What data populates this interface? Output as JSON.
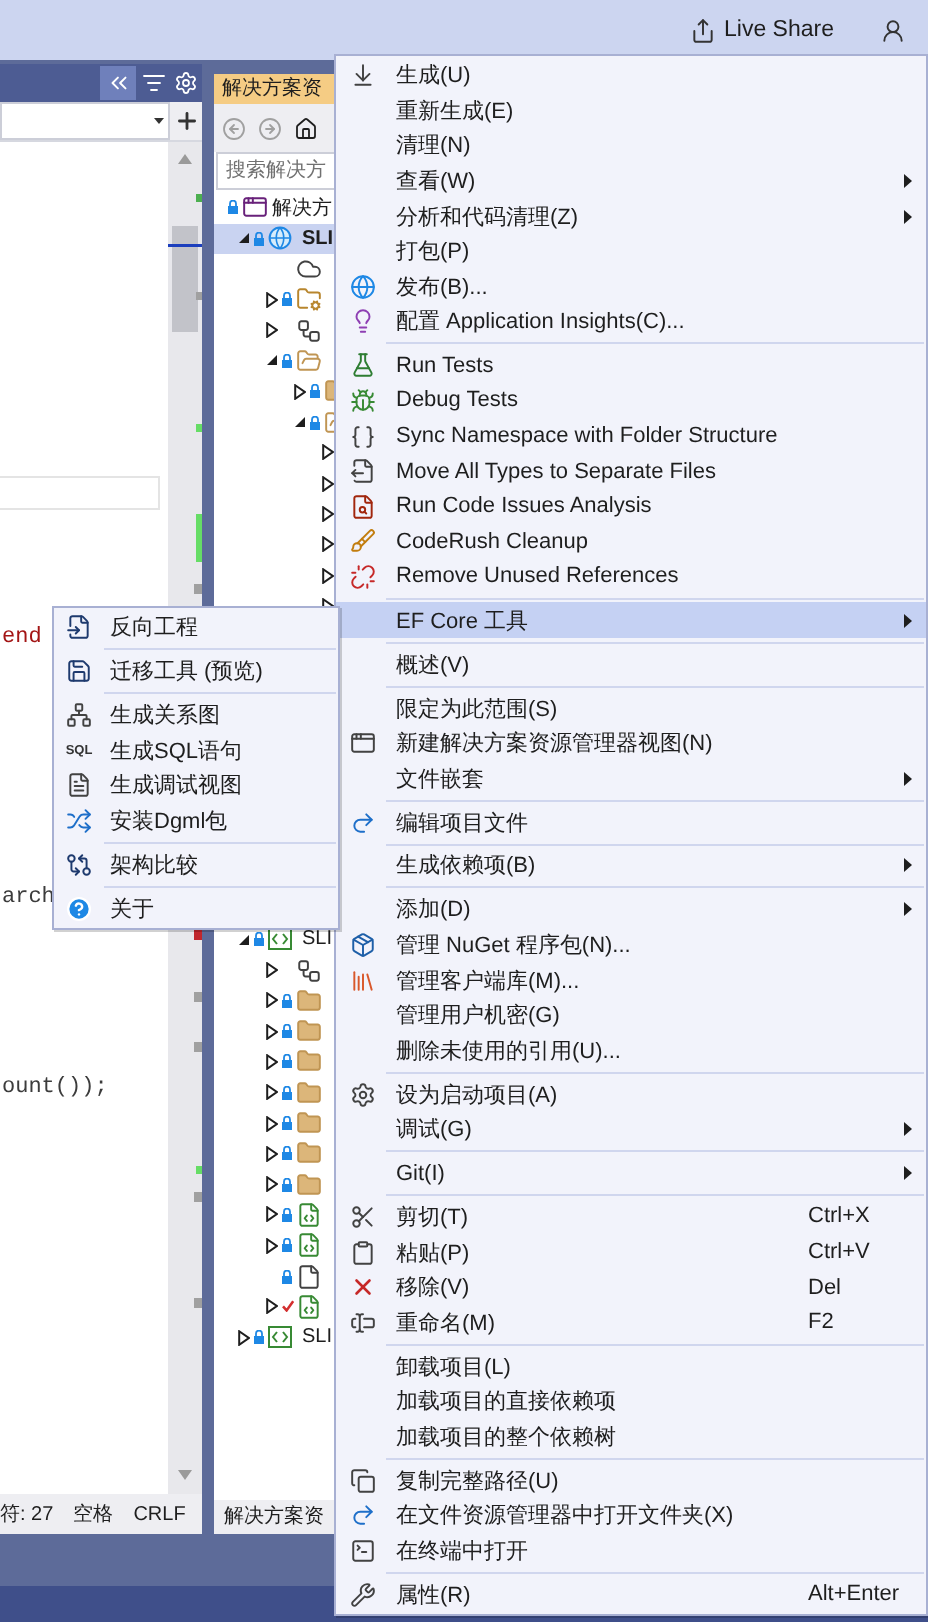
{
  "top_bar": {
    "live_share": "Live Share"
  },
  "editor": {
    "code_lines": [
      {
        "text": "end",
        "kind": "string"
      },
      {
        "text": "arch",
        "kind": "plain"
      },
      {
        "text": "ount());",
        "kind": "plain"
      }
    ],
    "status_bar": [
      "符: 27",
      "空格",
      "CRLF"
    ]
  },
  "solution_explorer": {
    "title": "解决方案资",
    "search": {
      "placeholder": "搜索解决方"
    },
    "tree": [
      {
        "label": "解决方",
        "kind": "solution",
        "locked": true,
        "selected": false,
        "children": [
          {
            "label": "SLI",
            "kind": "web-project",
            "locked": true,
            "expanded": true,
            "selected": true,
            "children": [
              {
                "kind": "cloud",
                "locked": false,
                "selected": false
              },
              {
                "kind": "folder-gear",
                "locked": true,
                "expanded": false,
                "selected": false
              },
              {
                "kind": "deps",
                "locked": false,
                "expanded": false,
                "selected": false
              },
              {
                "kind": "folder-open",
                "locked": true,
                "expanded": true,
                "selected": false,
                "children": [
                  {
                    "kind": "folder",
                    "locked": true,
                    "expanded": false,
                    "selected": false
                  },
                  {
                    "kind": "folder-open",
                    "locked": true,
                    "expanded": true,
                    "selected": false,
                    "children": [
                      {
                        "expanded": false,
                        "selected": false
                      },
                      {
                        "expanded": false,
                        "selected": false
                      },
                      {
                        "expanded": false,
                        "selected": false
                      },
                      {
                        "expanded": false,
                        "selected": false
                      },
                      {
                        "expanded": false,
                        "selected": false
                      },
                      {
                        "expanded": false,
                        "selected": false
                      }
                    ]
                  }
                ]
              }
            ]
          },
          {
            "label": "SLI",
            "kind": "cs-project",
            "locked": true,
            "expanded": true,
            "selected": false,
            "children": [
              {
                "kind": "deps",
                "locked": false,
                "expanded": false,
                "selected": false
              },
              {
                "kind": "folder",
                "locked": true,
                "expanded": false,
                "selected": false
              },
              {
                "kind": "folder",
                "locked": true,
                "expanded": false,
                "selected": false
              },
              {
                "kind": "folder",
                "locked": true,
                "expanded": false,
                "selected": false
              },
              {
                "kind": "folder",
                "locked": true,
                "expanded": false,
                "selected": false
              },
              {
                "kind": "folder",
                "locked": true,
                "expanded": false,
                "selected": false
              },
              {
                "kind": "folder",
                "locked": true,
                "expanded": false,
                "selected": false
              },
              {
                "kind": "folder",
                "locked": true,
                "expanded": false,
                "selected": false
              },
              {
                "kind": "cs-file",
                "locked": true,
                "expanded": false,
                "selected": false
              },
              {
                "kind": "cs-file",
                "locked": true,
                "expanded": false,
                "selected": false
              },
              {
                "kind": "file",
                "locked": true,
                "selected": false
              },
              {
                "kind": "cs-file",
                "locked": false,
                "edited": true,
                "expanded": false,
                "selected": false
              }
            ]
          },
          {
            "label": "SLI",
            "kind": "cs-project",
            "locked": true,
            "expanded": false,
            "selected": false
          }
        ]
      }
    ],
    "bottom_tab": "解决方案资"
  },
  "context_menu": {
    "groups": [
      {
        "items": [
          {
            "label": "生成(U)",
            "kind": "build",
            "submenu": false,
            "highlighted": false
          },
          {
            "label": "重新生成(E)",
            "submenu": false,
            "highlighted": false
          },
          {
            "label": "清理(N)",
            "submenu": false,
            "highlighted": false
          },
          {
            "label": "查看(W)",
            "submenu": true,
            "highlighted": false
          },
          {
            "label": "分析和代码清理(Z)",
            "submenu": true,
            "highlighted": false
          },
          {
            "label": "打包(P)",
            "submenu": false,
            "highlighted": false
          },
          {
            "label": "发布(B)...",
            "kind": "publish",
            "submenu": false,
            "highlighted": false
          },
          {
            "label": "配置 Application Insights(C)...",
            "kind": "insights",
            "submenu": false,
            "highlighted": false
          }
        ]
      },
      {
        "items": [
          {
            "label": "Run Tests",
            "kind": "run-tests",
            "submenu": false,
            "highlighted": false
          },
          {
            "label": "Debug Tests",
            "kind": "debug-tests",
            "submenu": false,
            "highlighted": false
          },
          {
            "label": "Sync Namespace with Folder Structure",
            "kind": "braces",
            "submenu": false,
            "highlighted": false
          },
          {
            "label": "Move All Types to Separate Files",
            "kind": "move-types",
            "submenu": false,
            "highlighted": false
          },
          {
            "label": "Run Code Issues Analysis",
            "kind": "code-issues",
            "submenu": false,
            "highlighted": false
          },
          {
            "label": "CodeRush Cleanup",
            "kind": "cleanup",
            "submenu": false,
            "highlighted": false
          },
          {
            "label": "Remove Unused References",
            "kind": "remove-refs",
            "submenu": false,
            "highlighted": false
          }
        ]
      },
      {
        "items": [
          {
            "label": "EF Core 工具",
            "submenu": true,
            "highlighted": true
          }
        ]
      },
      {
        "items": [
          {
            "label": "概述(V)",
            "submenu": false,
            "highlighted": false
          }
        ]
      },
      {
        "items": [
          {
            "label": "限定为此范围(S)",
            "submenu": false,
            "highlighted": false
          },
          {
            "label": "新建解决方案资源管理器视图(N)",
            "kind": "new-view",
            "submenu": false,
            "highlighted": false
          },
          {
            "label": "文件嵌套",
            "submenu": true,
            "highlighted": false
          }
        ]
      },
      {
        "items": [
          {
            "label": "编辑项目文件",
            "kind": "redo",
            "submenu": false,
            "highlighted": false
          }
        ]
      },
      {
        "items": [
          {
            "label": "生成依赖项(B)",
            "submenu": true,
            "highlighted": false
          }
        ]
      },
      {
        "items": [
          {
            "label": "添加(D)",
            "submenu": true,
            "highlighted": false
          },
          {
            "label": "管理 NuGet 程序包(N)...",
            "kind": "nuget",
            "submenu": false,
            "highlighted": false
          },
          {
            "label": "管理客户端库(M)...",
            "kind": "library",
            "submenu": false,
            "highlighted": false
          },
          {
            "label": "管理用户机密(G)",
            "submenu": false,
            "highlighted": false
          },
          {
            "label": "删除未使用的引用(U)...",
            "submenu": false,
            "highlighted": false
          }
        ]
      },
      {
        "items": [
          {
            "label": "设为启动项目(A)",
            "kind": "settings",
            "submenu": false,
            "highlighted": false
          },
          {
            "label": "调试(G)",
            "submenu": true,
            "highlighted": false
          }
        ]
      },
      {
        "items": [
          {
            "label": "Git(I)",
            "submenu": true,
            "highlighted": false
          }
        ]
      },
      {
        "items": [
          {
            "label": "剪切(T)",
            "kind": "cut",
            "shortcut": "Ctrl+X",
            "submenu": false,
            "highlighted": false
          },
          {
            "label": "粘贴(P)",
            "kind": "paste",
            "shortcut": "Ctrl+V",
            "submenu": false,
            "highlighted": false
          },
          {
            "label": "移除(V)",
            "kind": "remove",
            "shortcut": "Del",
            "submenu": false,
            "highlighted": false
          },
          {
            "label": "重命名(M)",
            "kind": "rename",
            "shortcut": "F2",
            "submenu": false,
            "highlighted": false
          }
        ]
      },
      {
        "items": [
          {
            "label": "卸载项目(L)",
            "submenu": false,
            "highlighted": false
          },
          {
            "label": "加载项目的直接依赖项",
            "submenu": false,
            "highlighted": false
          },
          {
            "label": "加载项目的整个依赖树",
            "submenu": false,
            "highlighted": false
          }
        ]
      },
      {
        "items": [
          {
            "label": "复制完整路径(U)",
            "kind": "copy",
            "submenu": false,
            "highlighted": false
          },
          {
            "label": "在文件资源管理器中打开文件夹(X)",
            "kind": "redo",
            "submenu": false,
            "highlighted": false
          },
          {
            "label": "在终端中打开",
            "kind": "terminal",
            "submenu": false,
            "highlighted": false
          }
        ]
      },
      {
        "items": [
          {
            "label": "属性(R)",
            "kind": "wrench",
            "shortcut": "Alt+Enter",
            "submenu": false,
            "highlighted": false
          }
        ]
      }
    ]
  },
  "submenu": {
    "groups": [
      {
        "items": [
          {
            "label": "反向工程",
            "kind": "reverse"
          }
        ]
      },
      {
        "items": [
          {
            "label": "迁移工具 (预览)",
            "kind": "migrate"
          }
        ]
      },
      {
        "items": [
          {
            "label": "生成关系图",
            "kind": "diagram"
          },
          {
            "label": "生成SQL语句",
            "icon_text": "SQL"
          },
          {
            "label": "生成调试视图",
            "kind": "document"
          },
          {
            "label": "安装Dgml包",
            "kind": "dgml"
          }
        ]
      },
      {
        "items": [
          {
            "label": "架构比较",
            "kind": "compare"
          }
        ]
      },
      {
        "items": [
          {
            "label": "关于",
            "kind": "about"
          }
        ]
      }
    ]
  }
}
